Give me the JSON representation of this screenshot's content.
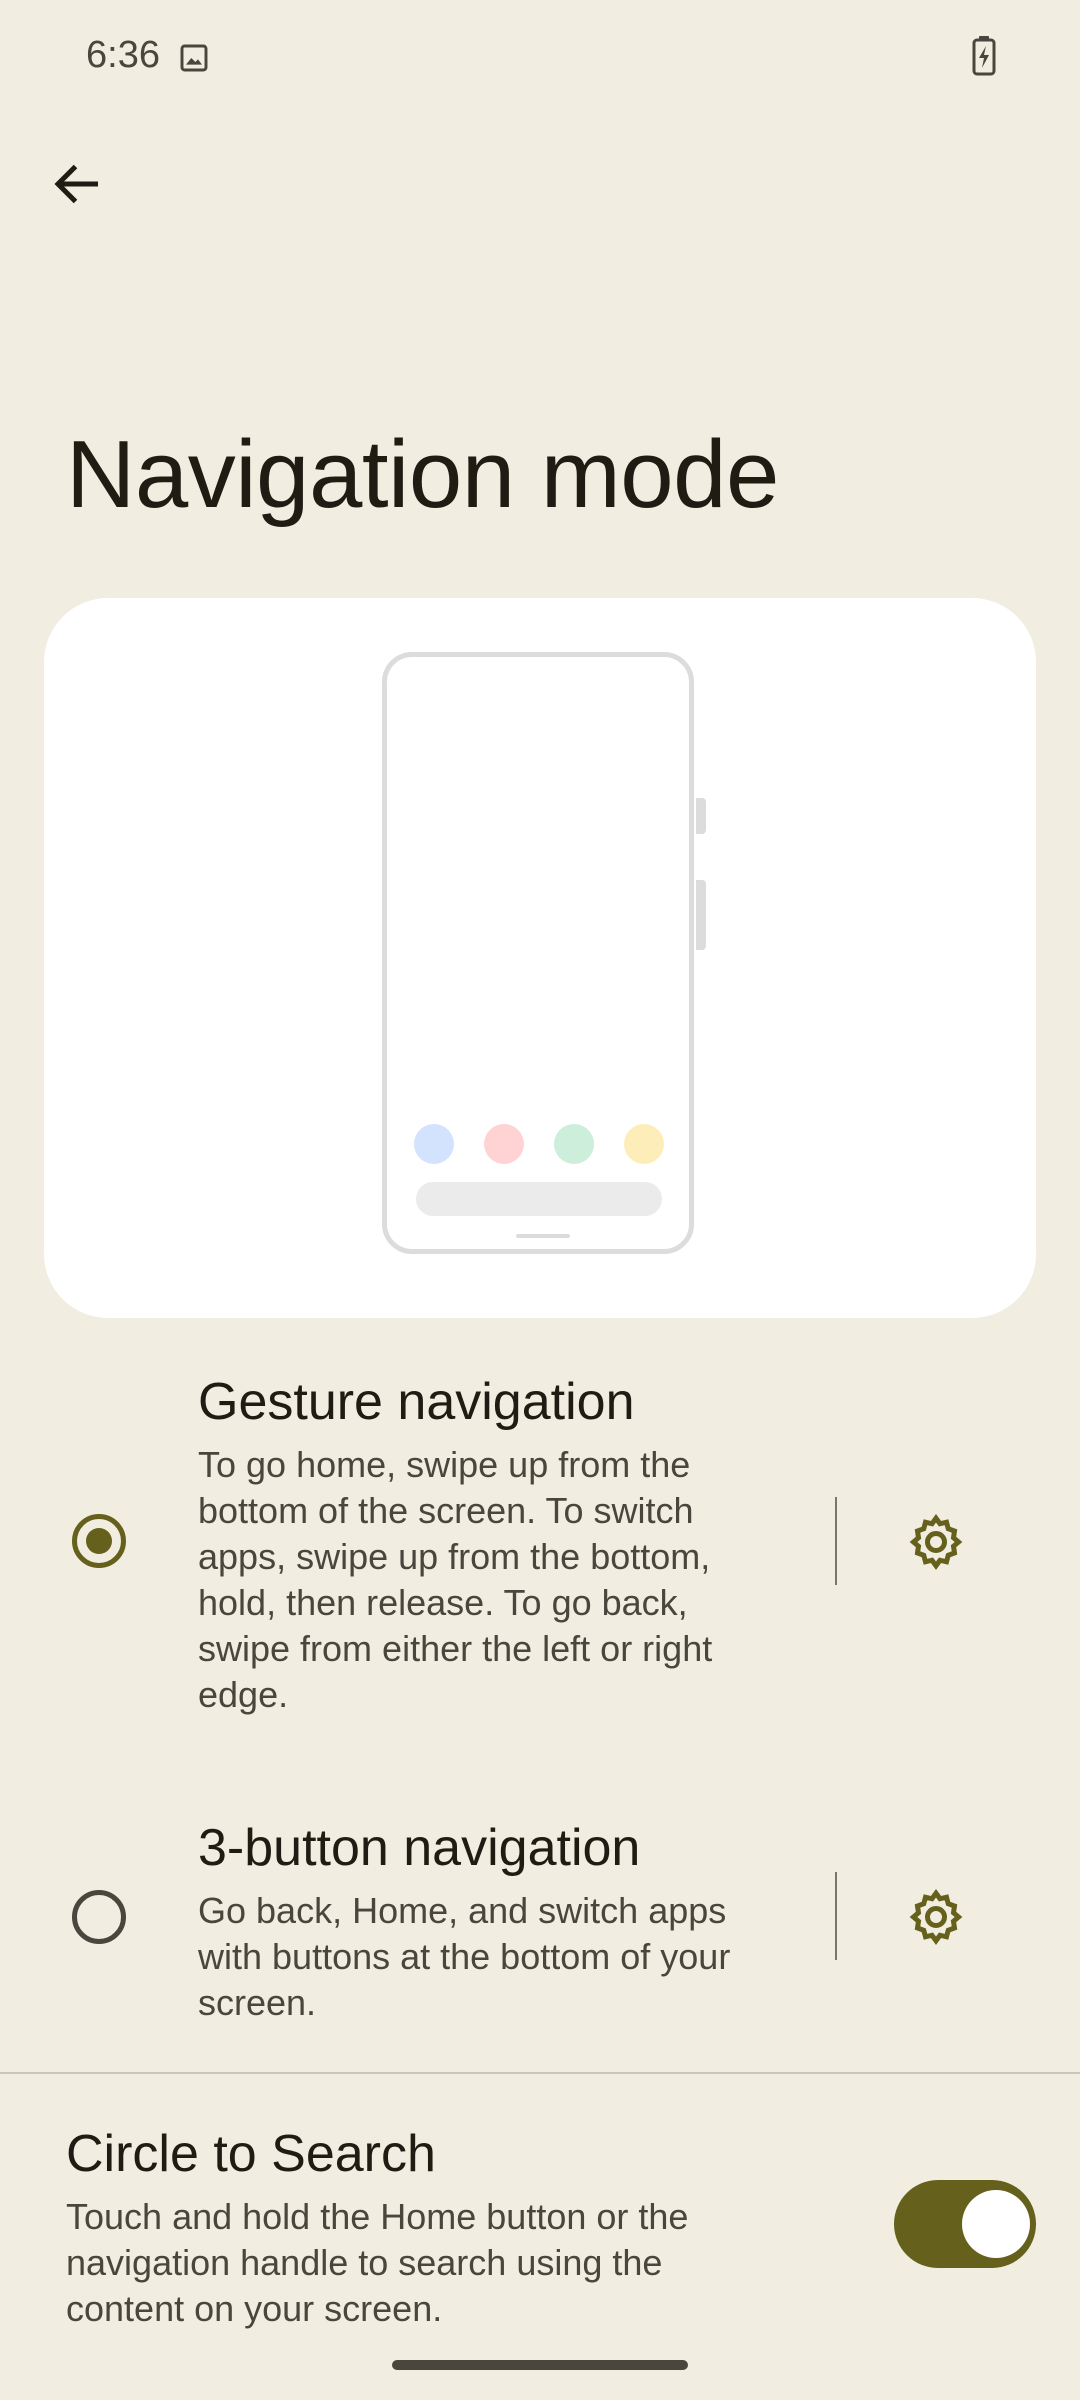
{
  "status_bar": {
    "time": "6:36"
  },
  "page": {
    "title": "Navigation mode"
  },
  "illustration": {
    "dot_colors": [
      "#d3e3fd",
      "#ffd3d3",
      "#cdeedb",
      "#fdedb8"
    ]
  },
  "options": [
    {
      "title": "Gesture navigation",
      "lines": [
        "To go home, swipe up from the",
        "bottom of the screen. To switch",
        "apps, swipe up from the bottom,",
        "hold, then release. To go back,",
        "swipe from either the left or right",
        "edge."
      ],
      "selected": true
    },
    {
      "title": "3-button navigation",
      "lines": [
        "Go back, Home, and switch apps",
        "with buttons at the bottom of your",
        "screen."
      ],
      "selected": false
    }
  ],
  "circle_to_search": {
    "title": "Circle to Search",
    "lines": [
      "Touch and hold the Home button or the",
      "navigation handle to search using the",
      "content on your screen."
    ],
    "enabled": true
  },
  "colors": {
    "accent": "#65601b",
    "background": "#f1ede0"
  }
}
